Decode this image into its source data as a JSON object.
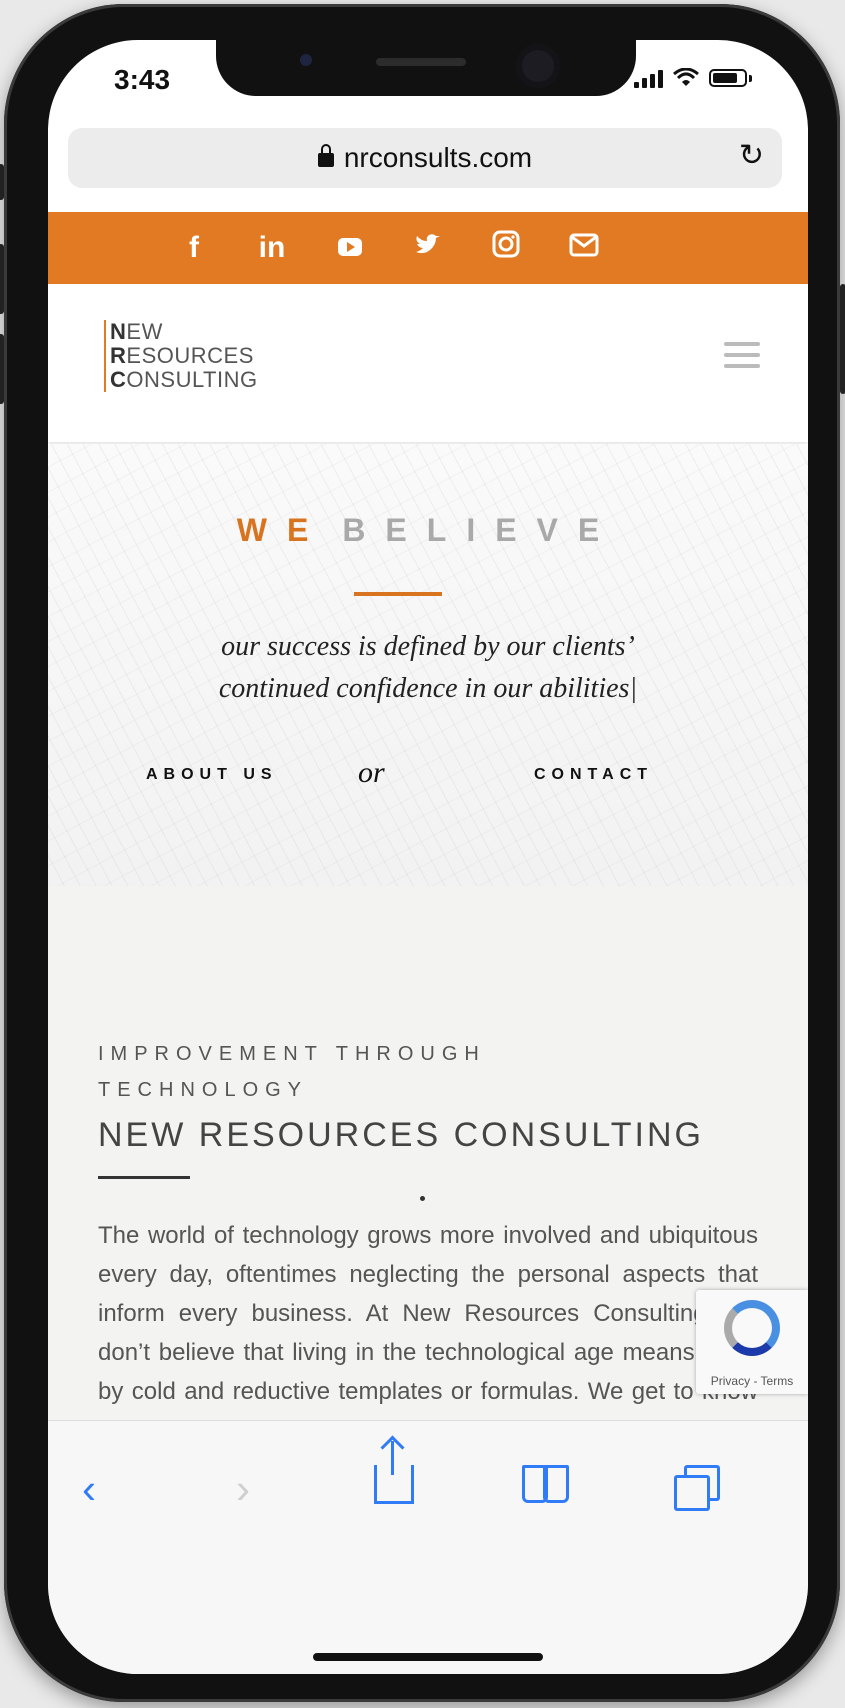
{
  "status": {
    "time": "3:43"
  },
  "browser": {
    "url": "nrconsults.com"
  },
  "social_icons": [
    {
      "name": "facebook-icon",
      "glyph": "f"
    },
    {
      "name": "linkedin-icon",
      "glyph": "in"
    },
    {
      "name": "youtube-icon",
      "glyph": "▶"
    },
    {
      "name": "twitter-icon",
      "glyph": "🐦"
    },
    {
      "name": "instagram-icon",
      "glyph": "◎"
    },
    {
      "name": "email-icon",
      "glyph": "✉"
    }
  ],
  "logo": {
    "l1_initial": "N",
    "l1_rest": "EW",
    "l2_initial": "R",
    "l2_rest": "ESOURCES",
    "l3_initial": "C",
    "l3_rest": "ONSULTING"
  },
  "hero": {
    "title_1": "WE",
    "title_2": "BELIEVE",
    "quote_line1": "our success is defined by our clients’",
    "quote_line2": "continued confidence in our abilities|",
    "link_about": "ABOUT US",
    "link_or": "or",
    "link_contact": "CONTACT"
  },
  "content": {
    "eyebrow": "IMPROVEMENT THROUGH TECHNOLOGY",
    "heading": "NEW RESOURCES CONSULTING",
    "body": "The world of technology grows more involved and ubiquitous every day, oftentimes neglecting the personal aspects that inform every business. At New Resources Consulting, we don’t believe that living in the technological age means living by cold and reductive templates or formulas. We get to know the people behind"
  },
  "recaptcha": {
    "text": "Privacy - Terms"
  },
  "colors": {
    "accent": "#e17a22",
    "ios_blue": "#2f7cf6"
  }
}
